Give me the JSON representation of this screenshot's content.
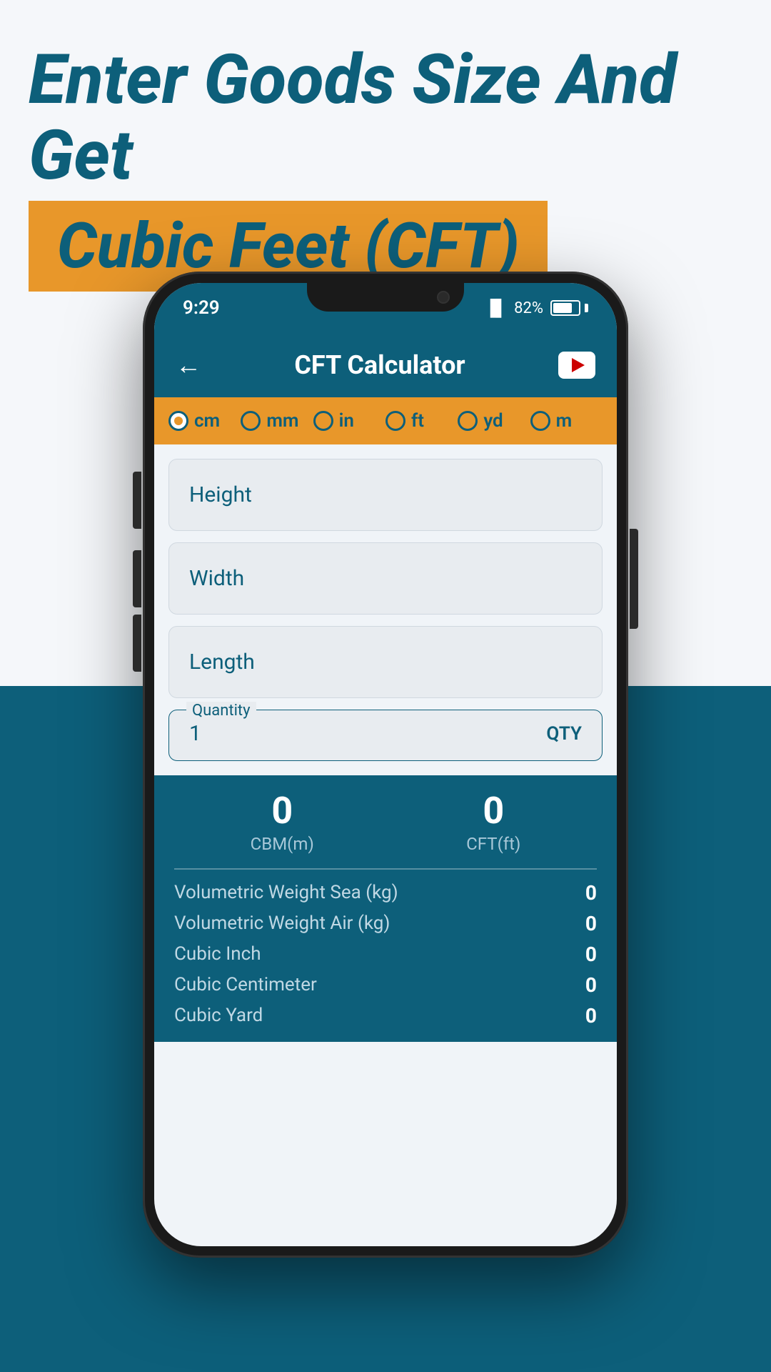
{
  "page": {
    "background_top": "#f5f7fa",
    "background_bottom": "#0d5f7a"
  },
  "header": {
    "line1": "Enter Goods Size And Get",
    "line2": "Cubic Feet (CFT)"
  },
  "phone": {
    "status_bar": {
      "time": "9:29",
      "signal": "82%"
    },
    "app_bar": {
      "back_label": "←",
      "title": "CFT Calculator",
      "youtube_icon": "youtube-icon"
    },
    "unit_selector": {
      "options": [
        {
          "label": "cm",
          "selected": true
        },
        {
          "label": "mm",
          "selected": false
        },
        {
          "label": "in",
          "selected": false
        },
        {
          "label": "ft",
          "selected": false
        },
        {
          "label": "yd",
          "selected": false
        },
        {
          "label": "m",
          "selected": false
        }
      ]
    },
    "inputs": {
      "height_placeholder": "Height",
      "width_placeholder": "Width",
      "length_placeholder": "Length",
      "quantity_label": "Quantity",
      "quantity_value": "1",
      "qty_badge": "QTY"
    },
    "results": {
      "cbm_value": "0",
      "cbm_unit": "CBM(m)",
      "cft_value": "0",
      "cft_unit": "CFT(ft)",
      "rows": [
        {
          "label": "Volumetric Weight Sea (kg)",
          "value": "0"
        },
        {
          "label": "Volumetric Weight Air (kg)",
          "value": "0"
        },
        {
          "label": "Cubic Inch",
          "value": "0"
        },
        {
          "label": "Cubic Centimeter",
          "value": "0"
        },
        {
          "label": "Cubic Yard",
          "value": "0"
        }
      ]
    }
  }
}
